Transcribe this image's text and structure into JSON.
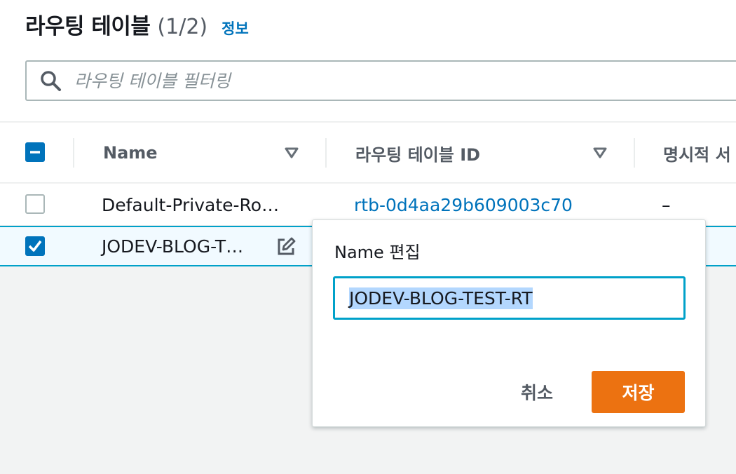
{
  "header": {
    "title": "라우팅 테이블",
    "count": "(1/2)",
    "info_link": "정보"
  },
  "filter": {
    "placeholder": "라우팅 테이블 필터링",
    "value": ""
  },
  "table": {
    "columns": [
      "Name",
      "라우팅 테이블 ID",
      "명시적 서"
    ],
    "rows": [
      {
        "name": "Default-Private-Ro…",
        "id": "rtb-0d4aa29b609003c70",
        "explicit": "–",
        "selected": false
      },
      {
        "name": "JODEV-BLOG-T…",
        "id": "",
        "explicit": "",
        "selected": true
      }
    ]
  },
  "popover": {
    "title": "Name 편집",
    "input_value": "JODEV-BLOG-TEST-RT",
    "cancel_label": "취소",
    "save_label": "저장"
  },
  "colors": {
    "accent": "#0073bb",
    "save_button": "#ec7211",
    "focus_border": "#00a1c9",
    "selection": "#b3d7fe"
  },
  "icons": [
    "search-icon",
    "sort-down-icon",
    "edit-icon",
    "checkmark-icon",
    "indeterminate-icon"
  ]
}
